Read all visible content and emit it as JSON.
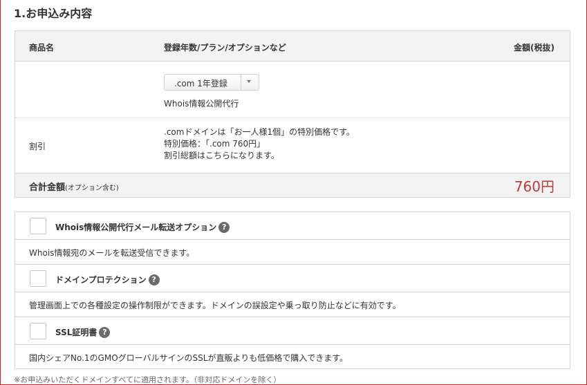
{
  "section": {
    "title": "1.お申込み内容"
  },
  "order_table": {
    "headers": {
      "name": "商品名",
      "plan": "登録年数/プラン/オプションなど",
      "price": "金額(税抜)"
    },
    "plan_select": {
      "selected": ".com 1年登録"
    },
    "whois_label": "Whois情報公開代行",
    "discount": {
      "label": "割引",
      "lines": [
        ".comドメインは「お一人様1個」の特別価格です。",
        "特別価格：「.com 760円」",
        "割引総額はこちらになります。"
      ]
    },
    "total": {
      "label": "合計金額",
      "note": "(オプション含む)",
      "price": "760円"
    }
  },
  "options": [
    {
      "title": "Whois情報公開代行メール転送オプション",
      "description": "Whois情報宛のメールを転送受信できます。"
    },
    {
      "title": "ドメインプロテクション",
      "description": "管理画面上での各種設定の操作制限ができます。ドメインの誤設定や乗っ取り防止などに有効です。"
    },
    {
      "title": "SSL証明書",
      "description": "国内シェアNo.1のGMOグローバルサインのSSLが直販よりも低価格で購入できます。"
    }
  ],
  "help_glyph": "?",
  "footnote": "※お申込みいただくドメインすべてに適用されます。（非対応ドメインを除く）",
  "colors": {
    "price": "#c0393b",
    "frame_border": "#cc2222",
    "header_bg": "#f3f3f3"
  },
  "icons": {
    "help": "question-circle-icon",
    "dropdown": "caret-down-icon"
  }
}
